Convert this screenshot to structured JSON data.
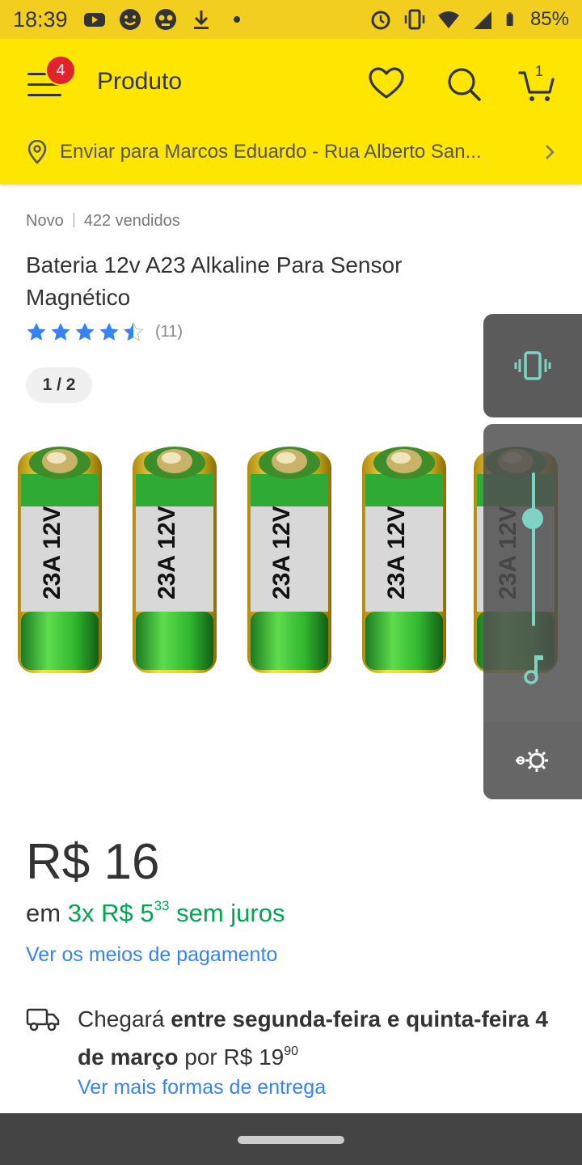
{
  "status_bar": {
    "time": "18:39",
    "battery": "85%",
    "icons": [
      "youtube-icon",
      "smiley-icon",
      "mask-icon",
      "download-icon",
      "dot-icon",
      "alarm-icon",
      "vibrate-icon",
      "wifi-icon",
      "signal-icon",
      "battery-icon"
    ]
  },
  "header": {
    "menu_badge": "4",
    "title": "Produto",
    "cart_count": "1",
    "shipping": "Enviar para Marcos Eduardo - Rua Alberto San..."
  },
  "product": {
    "condition": "Novo",
    "sold": "422 vendidos",
    "title": "Bateria 12v A23 Alkaline Para Sensor Magnético",
    "rating": 4.5,
    "reviews": "(11)",
    "pager": "1 / 2",
    "battery_label": "23A 12V"
  },
  "price": {
    "main": "R$ 16",
    "installments_prefix": "em",
    "installments_count": "3x",
    "installments_value": "R$ 5",
    "installments_cents": "33",
    "installments_suffix": "sem juros",
    "payment_link": "Ver os meios de pagamento"
  },
  "delivery": {
    "prefix": "Chegará",
    "window": "entre segunda-feira e quinta-feira 4 de março",
    "por": "por",
    "cost": "R$ 19",
    "cost_cents": "90",
    "more_link": "Ver mais formas de entrega"
  },
  "colors": {
    "header": "#ffe600",
    "status_bar": "#f2cf1f",
    "link": "#3483fa",
    "green": "#00a650",
    "star": "#3483fa",
    "badge": "#e0232d",
    "volume_accent": "#7fd3c5"
  }
}
